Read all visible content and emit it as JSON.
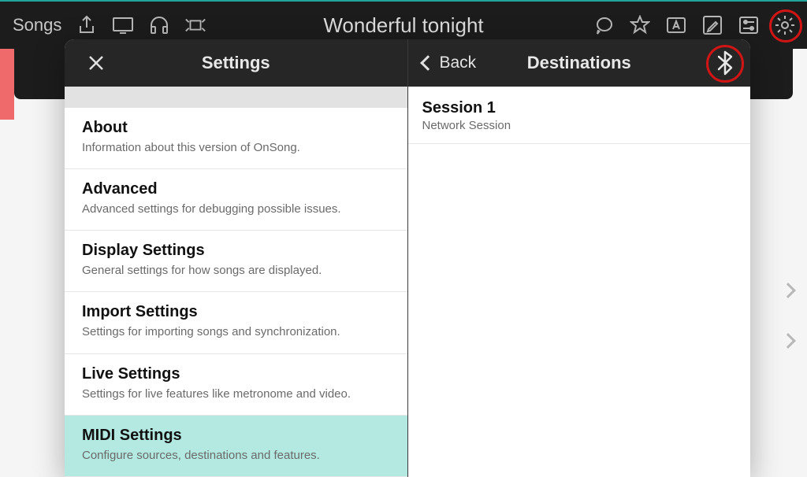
{
  "topbar": {
    "songs_label": "Songs",
    "title": "Wonderful tonight"
  },
  "settings_panel": {
    "title": "Settings",
    "items": [
      {
        "title": "About",
        "subtitle": "Information about this version of OnSong.",
        "selected": false
      },
      {
        "title": "Advanced",
        "subtitle": "Advanced settings for debugging possible issues.",
        "selected": false
      },
      {
        "title": "Display Settings",
        "subtitle": "General settings for how songs are displayed.",
        "selected": false
      },
      {
        "title": "Import Settings",
        "subtitle": "Settings for importing songs and synchronization.",
        "selected": false
      },
      {
        "title": "Live Settings",
        "subtitle": "Settings for live features like metronome and video.",
        "selected": false
      },
      {
        "title": "MIDI Settings",
        "subtitle": "Configure sources, destinations and features.",
        "selected": true
      }
    ]
  },
  "dest_panel": {
    "back_label": "Back",
    "title": "Destinations",
    "items": [
      {
        "title": "Session 1",
        "subtitle": "Network Session"
      }
    ]
  }
}
